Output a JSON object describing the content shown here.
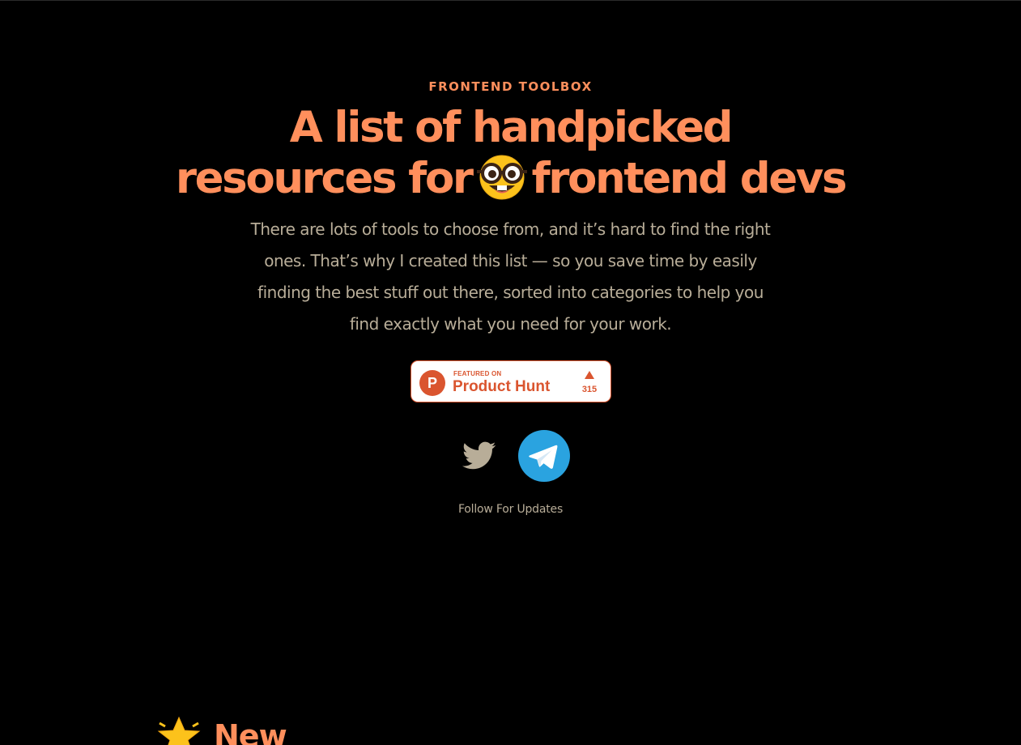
{
  "hero": {
    "eyebrow": "FRONTEND TOOLBOX",
    "headline_line1": "A list of handpicked",
    "headline_line2_before": "resources for",
    "headline_emoji": "nerd-face-icon",
    "headline_line2_after": "frontend devs",
    "description": "There are lots of tools to choose from, and it’s hard to find the right ones. That’s why I created this list — so you save time by easily finding the best stuff out there, sorted into categories to help you find exactly what you need for your work."
  },
  "product_hunt": {
    "logo_letter": "P",
    "featured_label": "FEATURED ON",
    "name": "Product Hunt",
    "upvotes": "315"
  },
  "social": {
    "twitter_icon": "twitter-icon",
    "telegram_icon": "telegram-icon",
    "follow_label": "Follow For Updates"
  },
  "sections": {
    "new_icon": "star-icon",
    "new_title": "New"
  },
  "colors": {
    "background": "#000000",
    "accent": "#ff8f5c",
    "body_text": "#b8ad98",
    "product_hunt": "#da552f",
    "telegram": "#2aa3e0"
  }
}
